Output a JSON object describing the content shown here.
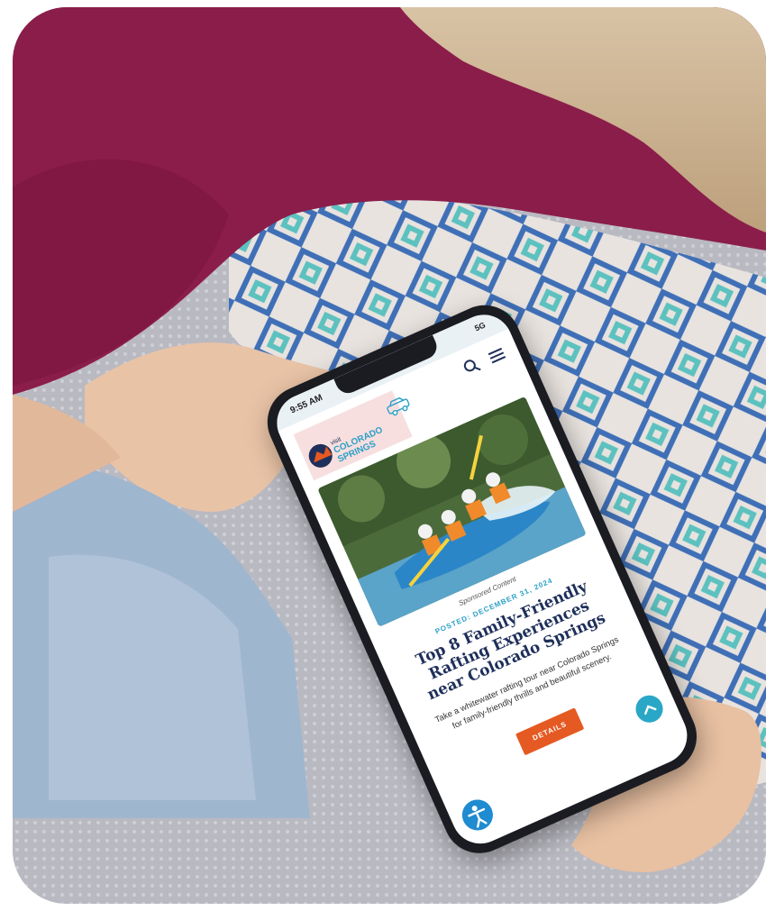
{
  "phone": {
    "status_time": "9:55 AM",
    "status_signal": "5G"
  },
  "site": {
    "logo_small": "visit",
    "logo_main_1": "COLORADO",
    "logo_main_2": "SPRINGS"
  },
  "article": {
    "sponsored_label": "Sponsored Content",
    "posted_date": "POSTED: DECEMBER 31, 2024",
    "title": "Top 8 Family-Friendly Rafting Experiences near Colorado Springs",
    "description": "Take a whitewater rafting tour near Colorado Springs for family-friendly thrills and beautiful scenery.",
    "cta_label": "DETAILS"
  },
  "icons": {
    "search": "search-icon",
    "menu": "menu-icon",
    "car": "car-icon",
    "scroll_top": "chevron-up-icon",
    "accessibility": "accessibility-icon"
  },
  "colors": {
    "sweater": "#8b1d4a",
    "jeans": "#9fb6cf",
    "pillow_blue": "#3f6fb6",
    "pillow_teal": "#5cc1bf",
    "cta": "#e55a22",
    "headline": "#1e2f5a",
    "accent": "#2aa0c8"
  }
}
